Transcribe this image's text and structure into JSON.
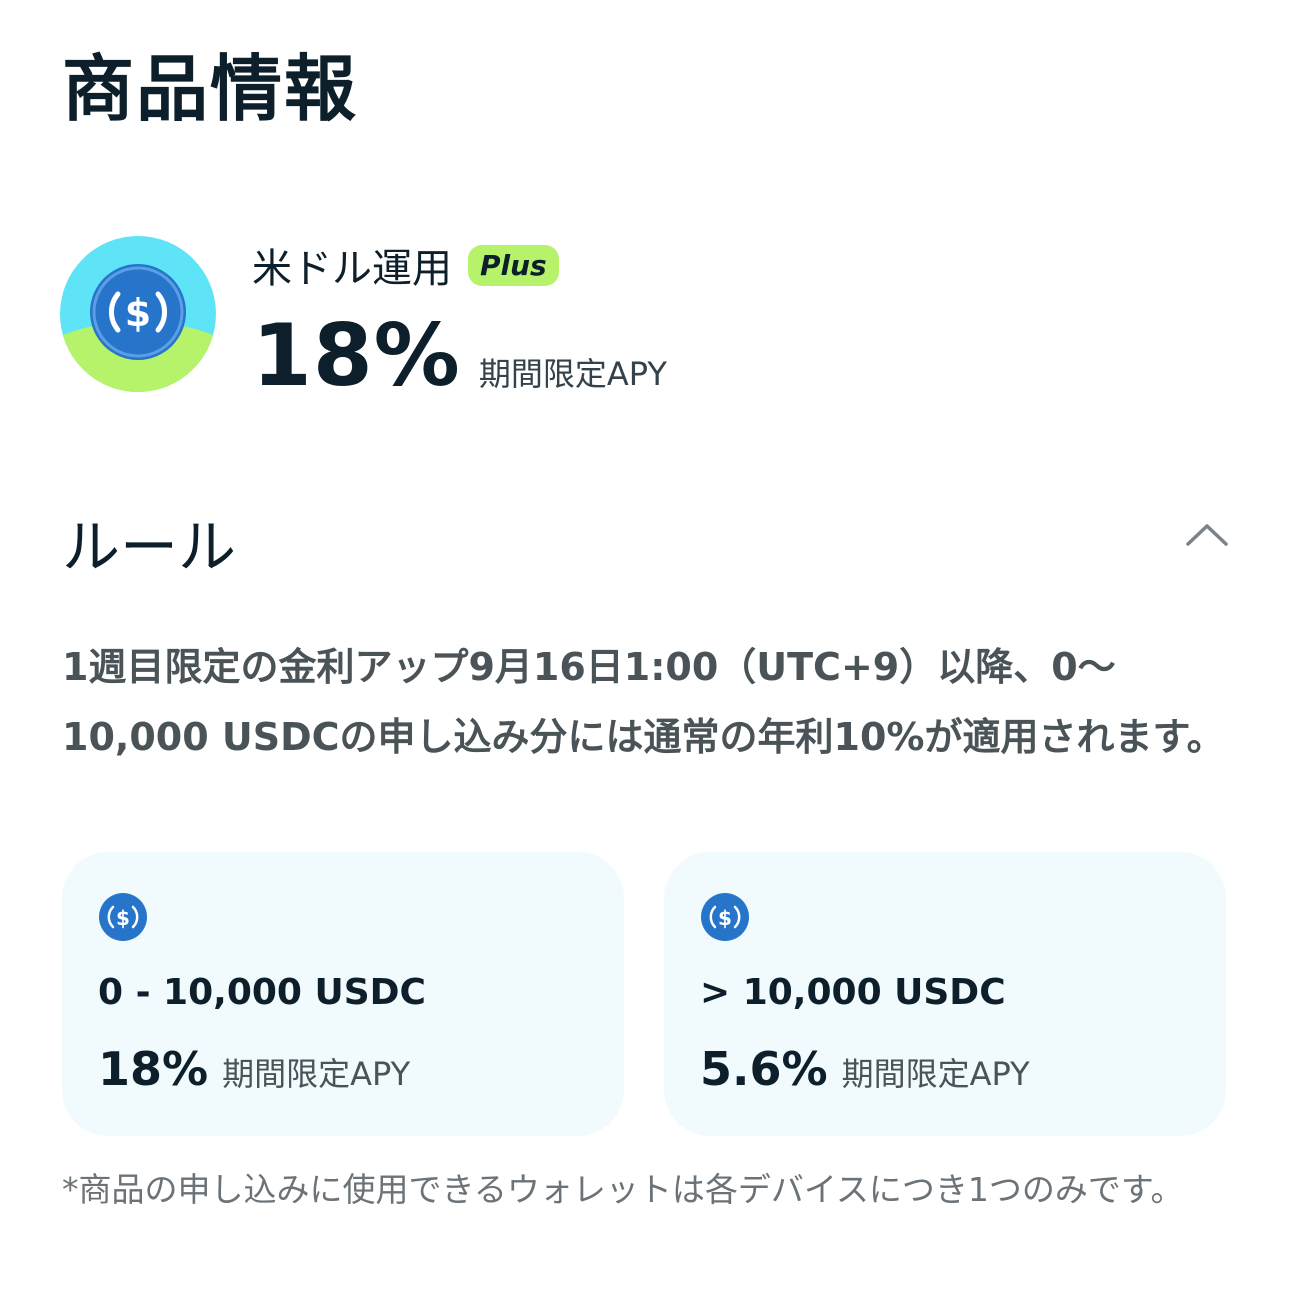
{
  "page": {
    "title": "商品情報"
  },
  "product": {
    "name": "米ドル運用",
    "badge": "Plus",
    "rate": "18%",
    "rate_suffix": "期間限定APY",
    "icon": "usdc-coin-icon"
  },
  "rules": {
    "header": "ルール",
    "toggle_icon": "chevron-up-icon",
    "description": "1週目限定の金利アップ9月16日1:00（UTC+9）以降、0〜10,000 USDCの申し込み分には通常の年利10%が適用されます。"
  },
  "tiers": [
    {
      "range": "0 - 10,000 USDC",
      "rate": "18%",
      "rate_suffix": "期間限定APY",
      "icon": "usdc-icon"
    },
    {
      "range": "> 10,000 USDC",
      "rate": "5.6%",
      "rate_suffix": "期間限定APY",
      "icon": "usdc-icon"
    }
  ],
  "footnote": "*商品の申し込みに使用できるウォレットは各デバイスにつき1つのみです。",
  "colors": {
    "text": "#0d1f2a",
    "badge_bg": "#b6f36a",
    "card_bg": "#f1fafd",
    "usdc_blue": "#2775ca",
    "icon_cyan": "#5fe4f7",
    "icon_green": "#b6f36a"
  }
}
